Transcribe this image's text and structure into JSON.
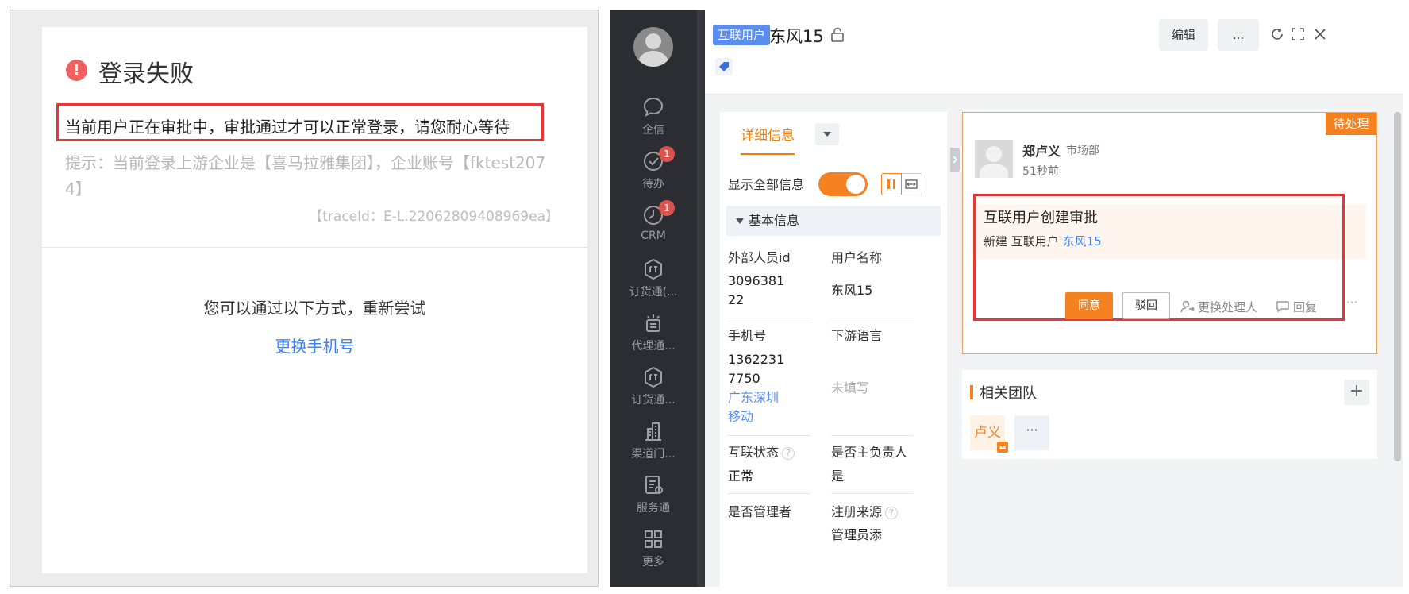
{
  "login": {
    "title": "登录失败",
    "message": "当前用户正在审批中，审批通过才可以正常登录，请您耐心等待",
    "hint": "提示：当前登录上游企业是【喜马拉雅集团】，企业账号【fktest2074】",
    "trace": "【traceId：E-L.22062809408969ea】",
    "retry": "您可以通过以下方式，重新尝试",
    "change_phone": "更换手机号"
  },
  "sidebar": {
    "items": [
      {
        "label": "企信",
        "icon": "chat-icon"
      },
      {
        "label": "待办",
        "icon": "check-circle-icon",
        "badge": "1"
      },
      {
        "label": "CRM",
        "icon": "clock-icon",
        "badge": "1"
      },
      {
        "label": "订货通(...",
        "icon": "order-icon"
      },
      {
        "label": "代理通...",
        "icon": "agent-icon"
      },
      {
        "label": "订货通...",
        "icon": "order-icon"
      },
      {
        "label": "渠道门...",
        "icon": "building-icon"
      },
      {
        "label": "服务通",
        "icon": "service-icon"
      },
      {
        "label": "更多",
        "icon": "grid-icon"
      }
    ]
  },
  "record": {
    "tag": "互联用户",
    "title": "东风15",
    "edit_label": "编辑",
    "more_label": "..."
  },
  "detail": {
    "tab": "详细信息",
    "show_all": "显示全部信息",
    "section": "基本信息",
    "fields": {
      "ext_id_label": "外部人员id",
      "ext_id_value_1": "3096381",
      "ext_id_value_2": "22",
      "user_name_label": "用户名称",
      "user_name_value": "东风15",
      "phone_label": "手机号",
      "phone_value_1": "1362231",
      "phone_value_2": "7750",
      "phone_region_1": "广东深圳",
      "phone_region_2": "移动",
      "lang_label": "下游语言",
      "lang_value": "未填写",
      "status_label": "互联状态",
      "status_value": "正常",
      "owner_label": "是否主负责人",
      "owner_value": "是",
      "admin_label": "是否管理者",
      "source_label": "注册来源",
      "source_value": "管理员添"
    }
  },
  "approval": {
    "pending": "待处理",
    "person": "郑卢义",
    "dept": "市场部",
    "time": "51秒前",
    "title": "互联用户创建审批",
    "line_prefix": "新建 互联用户",
    "line_link": "东风15",
    "agree": "同意",
    "reject": "驳回",
    "change_handler": "更换处理人",
    "reply": "回复",
    "more": "···"
  },
  "team": {
    "title": "相关团队",
    "member": "卢义",
    "more": "···",
    "add": "+"
  },
  "colors": {
    "accent": "#f58220",
    "link": "#3b82f6",
    "alert": "#e53935",
    "sidebar": "#2b2d33"
  }
}
